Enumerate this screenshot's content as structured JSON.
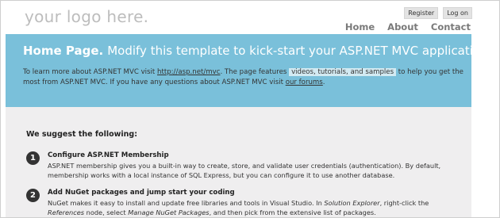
{
  "header": {
    "logo": "your logo here.",
    "auth": {
      "register": "Register",
      "login": "Log on"
    },
    "menu": {
      "home": "Home",
      "about": "About",
      "contact": "Contact"
    }
  },
  "featured": {
    "title": "Home Page.",
    "subtitle": "Modify this template to kick-start your ASP.NET MVC application.",
    "lead": {
      "t1": "To learn more about ASP.NET MVC visit ",
      "link1": "http://asp.net/mvc",
      "t2": ". The page features ",
      "highlight": "videos, tutorials, and samples",
      "t3": " to help you get the most from ASP.NET MVC. If you have any questions about ASP.NET MVC visit ",
      "link2": "our forums",
      "t4": "."
    }
  },
  "main": {
    "heading": "We suggest the following:",
    "steps": [
      {
        "number": "1",
        "title": "Configure ASP.NET Membership",
        "desc": "ASP.NET membership gives you a built-in way to create, store, and validate user credentials (authentication). By default, membership works with a local instance of SQL Express, but you can configure it to use another database."
      },
      {
        "number": "2",
        "title": "Add NuGet packages and jump start your coding",
        "d1": "NuGet makes it easy to install and update free libraries and tools in Visual Studio. In ",
        "d2": "Solution Explorer",
        "d3": ", right-click the ",
        "d4": "References",
        "d5": " node, select ",
        "d6": "Manage NuGet Packages",
        "d7": ", and then pick from the extensive list of packages."
      }
    ]
  },
  "colors": {
    "band": "#7ac0da",
    "body_bg": "#efeeef",
    "logo": "#bdbdbd",
    "menu": "#7a7a7a"
  }
}
